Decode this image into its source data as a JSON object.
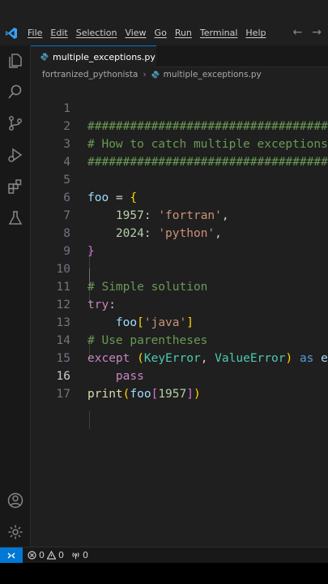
{
  "menu": [
    "File",
    "Edit",
    "Selection",
    "View",
    "Go",
    "Run",
    "Terminal",
    "Help"
  ],
  "tab": {
    "filename": "multiple_exceptions.py"
  },
  "breadcrumb": {
    "folder": "fortranized_pythonista",
    "file": "multiple_exceptions.py"
  },
  "editor": {
    "active_line": 16,
    "line_numbers": [
      "1",
      "2",
      "3",
      "4",
      "5",
      "6",
      "7",
      "8",
      "9",
      "10",
      "11",
      "12",
      "13",
      "14",
      "15",
      "16",
      "17"
    ],
    "lines": [
      "########################################",
      "# How to catch multiple exceptions",
      "########################################",
      "",
      "foo = {",
      "    1957: 'fortran',",
      "    2024: 'python',",
      "}",
      "",
      "# Simple solution",
      "try:",
      "    foo['java']",
      "# Use parentheses",
      "except (KeyError, ValueError) as e",
      "    pass",
      "print(foo[1957])",
      ""
    ]
  },
  "status": {
    "errors": "0",
    "warnings": "0",
    "ports": "0"
  },
  "colors": {
    "accent": "#0078d4",
    "background": "#1f1f1f",
    "comment": "#6a9955",
    "keyword": "#c586c0",
    "string": "#ce9178",
    "number": "#b5cea8"
  }
}
